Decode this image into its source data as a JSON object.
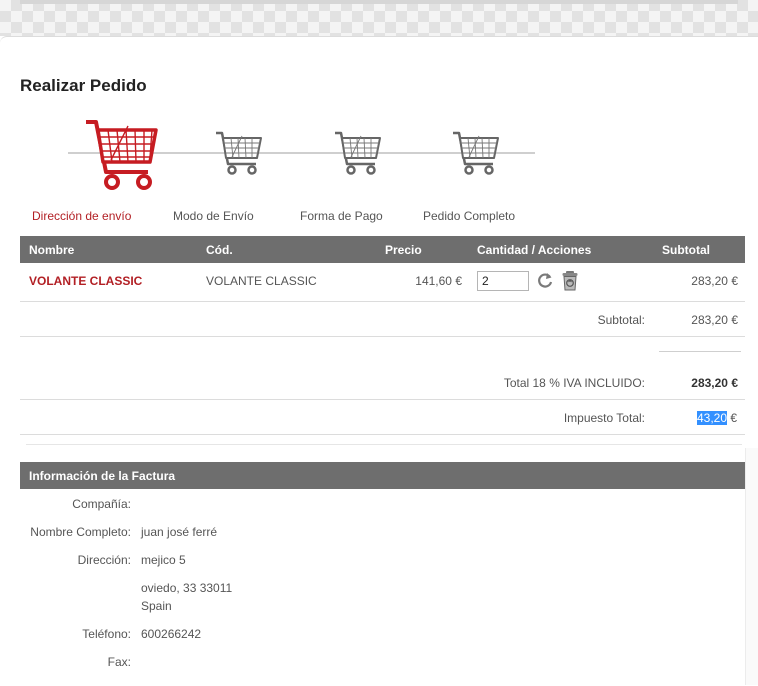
{
  "page": {
    "title": "Realizar Pedido"
  },
  "steps": [
    {
      "label": "Dirección de envío",
      "active": true
    },
    {
      "label": "Modo de Envío",
      "active": false
    },
    {
      "label": "Forma de Pago",
      "active": false
    },
    {
      "label": "Pedido Completo",
      "active": false
    }
  ],
  "cart_table": {
    "headers": {
      "name": "Nombre",
      "code": "Cód.",
      "price": "Precio",
      "qty_actions": "Cantidad / Acciones",
      "subtotal": "Subtotal"
    },
    "rows": [
      {
        "name": "VOLANTE CLASSIC",
        "code": "VOLANTE CLASSIC",
        "price": "141,60 €",
        "quantity": "2",
        "subtotal": "283,20 €"
      }
    ]
  },
  "totals": {
    "subtotal_label": "Subtotal:",
    "subtotal_value": "283,20 €",
    "total_label": "Total 18 % IVA INCLUIDO:",
    "total_value": "283,20 €",
    "tax_label": "Impuesto Total:",
    "tax_value_number": "43,20",
    "tax_value_currency": " €"
  },
  "billing": {
    "heading": "Información de la Factura",
    "company_label": "Compañía:",
    "company_value": "",
    "fullname_label": "Nombre Completo:",
    "fullname_value": "juan josé ferré",
    "address_label": "Dirección:",
    "address_line1": "mejico 5",
    "address_line2": "oviedo, 33 33011",
    "address_line3": "Spain",
    "phone_label": "Teléfono:",
    "phone_value": "600266242",
    "fax_label": "Fax:",
    "fax_value": ""
  },
  "colors": {
    "accent": "#b21f24",
    "header_bar": "#6e6e6e",
    "selection": "#3390ff"
  },
  "icons": {
    "active_cart": "shopping-cart-icon",
    "step_cart": "shopping-cart-icon",
    "update": "refresh-icon",
    "delete": "trash-icon"
  }
}
